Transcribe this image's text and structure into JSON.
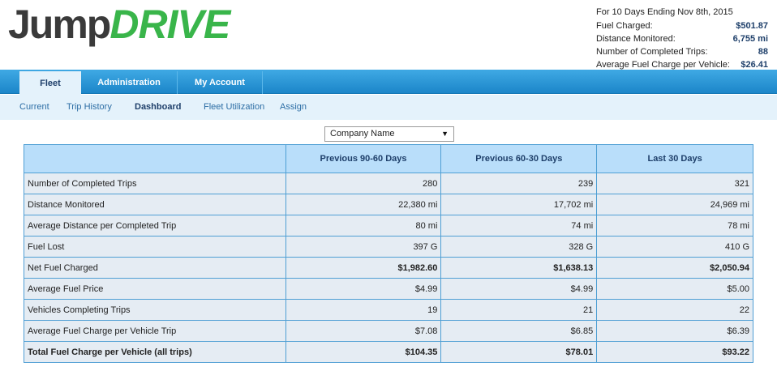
{
  "logo": {
    "part1": "Jump",
    "part2": "DRIVE"
  },
  "summary": {
    "period": "For 10 Days Ending Nov 8th, 2015",
    "rows": [
      {
        "label": "Fuel Charged:",
        "value": "$501.87"
      },
      {
        "label": "Distance Monitored:",
        "value": "6,755 mi"
      },
      {
        "label": "Number of Completed Trips:",
        "value": "88"
      },
      {
        "label": "Average Fuel Charge per Vehicle:",
        "value": "$26.41"
      }
    ]
  },
  "nav": {
    "tabs": [
      {
        "label": "Fleet",
        "active": true
      },
      {
        "label": "Administration",
        "active": false
      },
      {
        "label": "My Account",
        "active": false
      }
    ]
  },
  "subnav": {
    "items": [
      {
        "label": "Current",
        "active": false
      },
      {
        "label": "Trip History",
        "active": false
      },
      {
        "label": "Dashboard",
        "active": true
      },
      {
        "label": "Fleet Utilization",
        "active": false
      },
      {
        "label": "Assign",
        "active": false
      }
    ]
  },
  "company_select": {
    "value": "Company Name"
  },
  "table": {
    "columns": [
      "",
      "Previous 90-60 Days",
      "Previous 60-30 Days",
      "Last 30 Days"
    ],
    "rows": [
      {
        "label": "Number of Completed Trips",
        "values": [
          "280",
          "239",
          "321"
        ]
      },
      {
        "label": "Distance Monitored",
        "values": [
          "22,380 mi",
          "17,702 mi",
          "24,969 mi"
        ]
      },
      {
        "label": "Average Distance per Completed Trip",
        "values": [
          "80 mi",
          "74 mi",
          "78 mi"
        ]
      },
      {
        "label": "Fuel Lost",
        "values": [
          "397 G",
          "328 G",
          "410 G"
        ]
      },
      {
        "label": "Net Fuel Charged",
        "values": [
          "$1,982.60",
          "$1,638.13",
          "$2,050.94"
        ]
      },
      {
        "label": "Average Fuel Price",
        "values": [
          "$4.99",
          "$4.99",
          "$5.00"
        ]
      },
      {
        "label": "Vehicles Completing Trips",
        "values": [
          "19",
          "21",
          "22"
        ]
      },
      {
        "label": "Average Fuel Charge per Vehicle Trip",
        "values": [
          "$7.08",
          "$6.85",
          "$6.39"
        ]
      },
      {
        "label": "Total Fuel Charge per Vehicle (all trips)",
        "values": [
          "$104.35",
          "$78.01",
          "$93.22"
        ]
      }
    ]
  },
  "colors": {
    "brand_green": "#39b54a",
    "nav_blue": "#1c86c9",
    "header_blue": "#b9defa",
    "text_navy": "#1e3f6a"
  }
}
